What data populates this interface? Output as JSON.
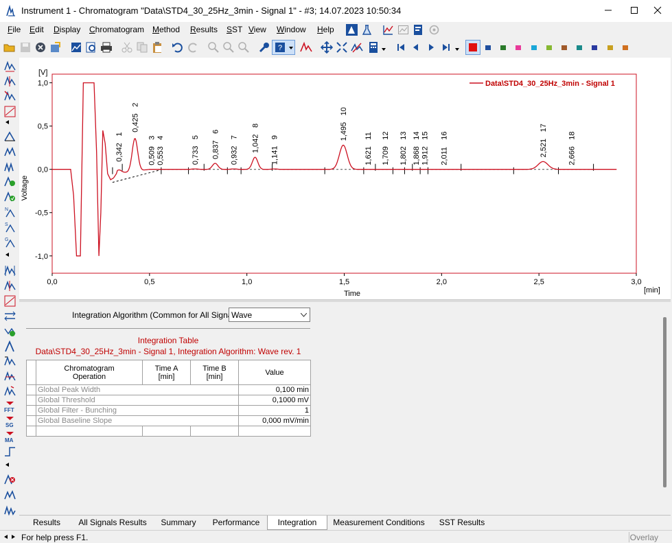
{
  "window": {
    "title": "Instrument 1 - Chromatogram \"Data\\STD4_30_25Hz_3min - Signal 1\" - #3;    14.07.2023    10:50:34",
    "controls": [
      "minimize-icon",
      "maximize-icon",
      "close-icon"
    ]
  },
  "menu": {
    "items": [
      {
        "label": "File",
        "u": "F",
        "rest": "ile"
      },
      {
        "label": "Edit",
        "u": "E",
        "rest": "dit"
      },
      {
        "label": "Display",
        "u": "D",
        "rest": "isplay"
      },
      {
        "label": "Chromatogram",
        "u": "C",
        "rest": "hromatogram"
      },
      {
        "label": "Method",
        "u": "M",
        "rest": "ethod"
      },
      {
        "label": "Results",
        "u": "R",
        "rest": "esults"
      },
      {
        "label": "SST",
        "u": "S",
        "rest": "ST"
      },
      {
        "label": "View",
        "u": "V",
        "rest": "iew"
      },
      {
        "label": "Window",
        "u": "W",
        "rest": "indow"
      },
      {
        "label": "Help",
        "u": "H",
        "rest": "elp"
      }
    ]
  },
  "colors": {
    "signal": "#cc1020",
    "legend": "#c00000",
    "palette": [
      "#1f4e9e",
      "#2a7a2a",
      "#e83a9a",
      "#1aa7d8",
      "#86b832",
      "#a05a2a",
      "#1a8a8a",
      "#2a3aa0",
      "#c8a020",
      "#d07020"
    ]
  },
  "chart_data": {
    "type": "line",
    "legend": "Data\\STD4_30_25Hz_3min - Signal 1",
    "ylabel": "Voltage",
    "yunit": "[V]",
    "xlabel": "Time",
    "xunit": "[min]",
    "xlim": [
      0,
      3.0
    ],
    "ylim": [
      -1.2,
      1.1
    ],
    "xticks": [
      "0,0",
      "0,5",
      "1,0",
      "1,5",
      "2,0",
      "2,5",
      "3,0"
    ],
    "yticks": [
      "1,0",
      "0,5",
      "0,0",
      "-0,5",
      "-1,0"
    ],
    "peaks": [
      {
        "n": "1",
        "rt": "0,342",
        "t": 0.342,
        "h": 0.04
      },
      {
        "n": "2",
        "rt": "0,425",
        "t": 0.425,
        "h": 0.38
      },
      {
        "n": "3",
        "rt": "0,509",
        "t": 0.509,
        "h": 0.0
      },
      {
        "n": "4",
        "rt": "0,553",
        "t": 0.553,
        "h": 0.0
      },
      {
        "n": "5",
        "rt": "0,733",
        "t": 0.733,
        "h": 0.005
      },
      {
        "n": "6",
        "rt": "0,837",
        "t": 0.837,
        "h": 0.07
      },
      {
        "n": "7",
        "rt": "0,932",
        "t": 0.932,
        "h": 0.005
      },
      {
        "n": "8",
        "rt": "1,042",
        "t": 1.042,
        "h": 0.14
      },
      {
        "n": "9",
        "rt": "1,141",
        "t": 1.141,
        "h": 0.005
      },
      {
        "n": "10",
        "rt": "1,495",
        "t": 1.495,
        "h": 0.28
      },
      {
        "n": "11",
        "rt": "1,621",
        "t": 1.621,
        "h": 0.0
      },
      {
        "n": "12",
        "rt": "1,709",
        "t": 1.709,
        "h": 0.0
      },
      {
        "n": "13",
        "rt": "1,802",
        "t": 1.802,
        "h": 0.0
      },
      {
        "n": "14",
        "rt": "1,868",
        "t": 1.868,
        "h": 0.0
      },
      {
        "n": "15",
        "rt": "1,912",
        "t": 1.912,
        "h": 0.0
      },
      {
        "n": "16",
        "rt": "2,011",
        "t": 2.011,
        "h": 0.0
      },
      {
        "n": "17",
        "rt": "2,521",
        "t": 2.521,
        "h": 0.09
      },
      {
        "n": "18",
        "rt": "2,666",
        "t": 2.666,
        "h": 0.0
      }
    ]
  },
  "panel": {
    "algo_label": "Integration Algorithm (Common for All Signals)",
    "algo_value": "Wave",
    "table_title": "Integration Table",
    "table_subtitle": "Data\\STD4_30_25Hz_3min - Signal 1, Integration Algorithm: Wave rev. 1",
    "headers": {
      "op1": "Chromatogram",
      "op2": "Operation",
      "ta1": "Time A",
      "ta2": "[min]",
      "tb1": "Time B",
      "tb2": "[min]",
      "val": "Value"
    },
    "rows": [
      {
        "op": "Global Peak Width",
        "value": "0,100 min"
      },
      {
        "op": "Global Threshold",
        "value": "0,1000 mV"
      },
      {
        "op": "Global Filter - Bunching",
        "value": "1"
      },
      {
        "op": "Global Baseline Slope",
        "value": "0,000 mV/min"
      }
    ]
  },
  "tabs": [
    "Results",
    "All Signals Results",
    "Summary",
    "Performance",
    "Integration",
    "Measurement Conditions",
    "SST Results"
  ],
  "active_tab": "Integration",
  "status": {
    "help": "For help press F1.",
    "mode": "Overlay"
  }
}
